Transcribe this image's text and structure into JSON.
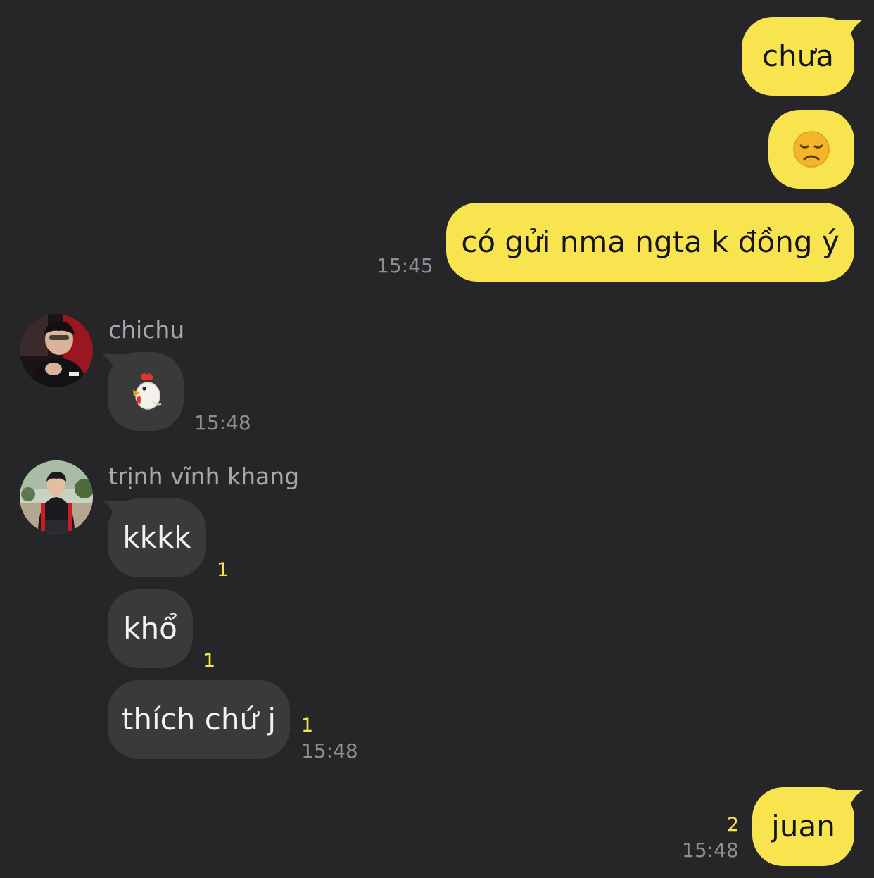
{
  "messages": [
    {
      "id": "m1",
      "direction": "outgoing",
      "text": "chưa"
    },
    {
      "id": "m2",
      "direction": "outgoing",
      "emoji": "disappointed-face-icon"
    },
    {
      "id": "m3",
      "direction": "outgoing",
      "text": "có gửi nma ngta k đồng ý",
      "time": "15:45"
    },
    {
      "id": "m4",
      "direction": "incoming",
      "sender": "chichu",
      "emoji": "chicken-icon",
      "time": "15:48"
    },
    {
      "id": "m5",
      "direction": "incoming",
      "sender": "trịnh vĩnh khang",
      "text": "kkkk",
      "unread": "1"
    },
    {
      "id": "m6",
      "direction": "incoming",
      "text": "khổ",
      "unread": "1"
    },
    {
      "id": "m7",
      "direction": "incoming",
      "text": "thích chứ j",
      "unread": "1",
      "time": "15:48"
    },
    {
      "id": "m8",
      "direction": "outgoing",
      "text": "juan",
      "unread": "2",
      "time": "15:48"
    }
  ],
  "senders": {
    "chichu": {
      "name": "chichu"
    },
    "khang": {
      "name": "trịnh vĩnh khang"
    }
  },
  "colors": {
    "background": "#262628",
    "outgoing_bubble": "#f7e44e",
    "incoming_bubble": "#3a3a3c",
    "timestamp": "#8e8e92",
    "unread_count": "#f7e44e",
    "sender_name": "#a8a8ac"
  }
}
